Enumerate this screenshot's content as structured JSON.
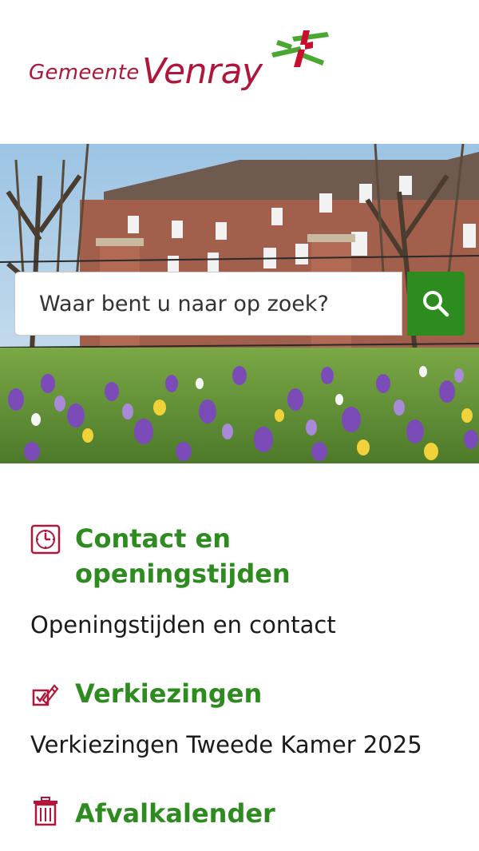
{
  "header": {
    "logo_small": "Gemeente",
    "logo_big": "Venray",
    "brand_color": "#b0153a",
    "accent_green": "#2e8b1f"
  },
  "hero": {
    "image": "photo-building-with-crocus-field"
  },
  "search": {
    "placeholder": "Waar bent u naar op zoek?",
    "button_icon": "search-icon"
  },
  "sections": [
    {
      "icon": "clock-icon",
      "title_line1": "Contact en",
      "title_line2": "openingstijden",
      "description": "Openingstijden en contact"
    },
    {
      "icon": "ballot-pen-icon",
      "title": "Verkiezingen",
      "description": "Verkiezingen Tweede Kamer 2025"
    },
    {
      "icon": "trash-bin-icon",
      "title": "Afvalkalender"
    }
  ]
}
